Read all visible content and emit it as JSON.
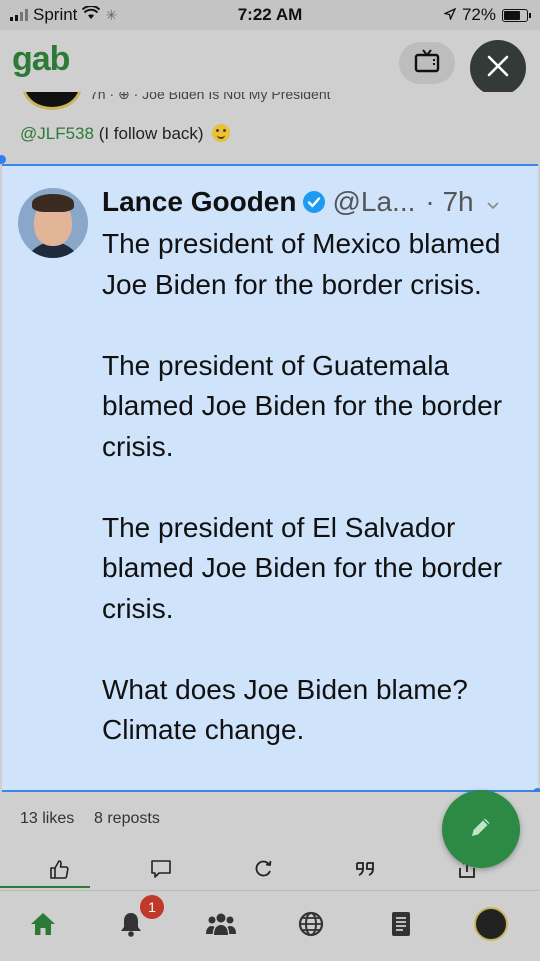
{
  "status_bar": {
    "carrier": "Sprint",
    "time": "7:22 AM",
    "battery": "72%",
    "icons": [
      "signal-icon",
      "wifi-icon",
      "loading-icon",
      "location-arrow-icon",
      "battery-icon"
    ]
  },
  "app": {
    "logo": "gab",
    "header_icons": [
      "tv-icon",
      "close-icon"
    ]
  },
  "background_post": {
    "meta": "7h · ⊕ · Joe Biden Is Not My President",
    "mention_handle": "@JLF538",
    "mention_text": "(I follow back)"
  },
  "tweet": {
    "name": "Lance Gooden",
    "handle": "@La...",
    "time": "· 7h",
    "paragraphs": [
      "The president of Mexico blamed Joe Biden for the border crisis.",
      "The president of Guatemala blamed Joe Biden for the border crisis.",
      "The president of El Salvador blamed Joe Biden for the border crisis.",
      "What does Joe Biden blame? Climate change."
    ]
  },
  "post_stats": {
    "likes": "13 likes",
    "reposts": "8 reposts"
  },
  "actions": [
    "like-icon",
    "comment-icon",
    "repost-icon",
    "quote-icon",
    "share-icon"
  ],
  "bottom_nav": {
    "notification_badge": "1",
    "items": [
      "home-icon",
      "notifications-icon",
      "groups-icon",
      "explore-icon",
      "news-icon",
      "profile-avatar"
    ]
  },
  "colors": {
    "brand_green": "#2d7a37",
    "selection_blue": "#cfe3fb",
    "verified_blue": "#1d9bf0"
  }
}
